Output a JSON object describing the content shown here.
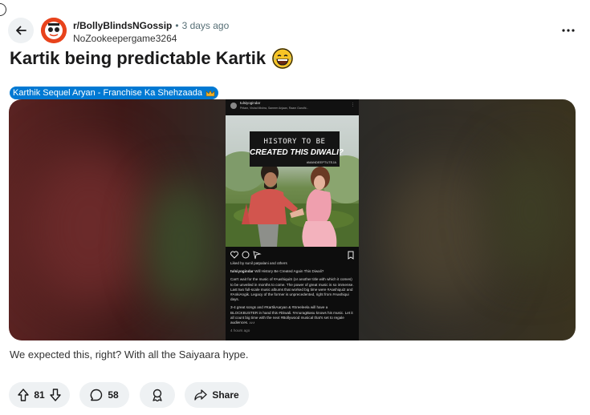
{
  "post": {
    "subreddit": "r/BollyBlindsNGossip",
    "separator": "•",
    "time_ago": "3 days ago",
    "author": "NoZookeepergame3264",
    "title": "Kartik being predictable Kartik",
    "flair": "Karthik Sequel Aryan - Franchise Ka Shehzaada",
    "body": "We expected this, right? With all the Saiyaara hype."
  },
  "media": {
    "ig_username": "tulsiyogindar",
    "ig_meta": "Pritam, Vishal Mishra, Sameer Anjaan, Raam Gandhi...",
    "caption_line1": "HISTORY TO BE",
    "caption_line2": "CREATED THIS DIWALI?",
    "caption_tag": "#MANDEEPTUTEJA",
    "liked_by": "Liked by sunil patpalani and others",
    "caption_head_user": "tulsiyogindar",
    "caption_head_text": "Will History Be Created Again This Diwali?",
    "para1": "Can't wait for the music of #AashiquiS (or another title with which it comes) to be unveiled in months to come. The power of great music is so immense. Last two full-scale music albums that worked big time were #Aashiqui2 and #AnkiAngik. Legacy of the former is unprecedented, right from #Aashiqui days.",
    "para2": "3-4 great songs and #KartikAaryan & #Sreeleela will have a BLOCKBUSTER in hand this #Diwali. #AnuragBasu knows his music. Let it all count big time with the next #Bollywood musical that's set to regale audiences. ♪♪♪",
    "posted": "4 hours ago"
  },
  "actions": {
    "upvotes": "81",
    "comments": "58",
    "share_label": "Share"
  },
  "colors": {
    "flair_bg": "#0079d3",
    "pill_bg": "#eef1f3",
    "avatar_bg": "#e8431c"
  },
  "icons": [
    "back-arrow-icon",
    "upvote-icon",
    "downvote-icon",
    "comment-icon",
    "award-icon",
    "share-icon",
    "more-dots-icon",
    "crown-icon",
    "laughing-emoji-icon"
  ]
}
